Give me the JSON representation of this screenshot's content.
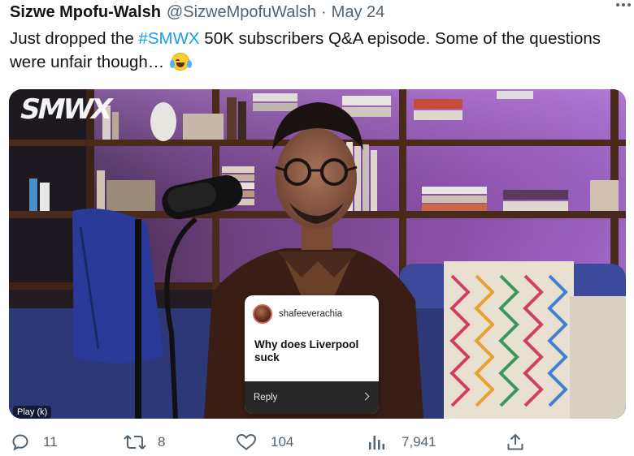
{
  "tweet": {
    "author_name": "Sizwe Mpofu-Walsh",
    "author_handle": "@SizweMpofuWalsh",
    "separator": "·",
    "time": "May 24",
    "text_before": "Just dropped the ",
    "hashtag": "#SMWX",
    "text_after": " 50K subscribers Q&A episode. Some of the questions were unfair though… ",
    "emoji": "face-with-tears-of-joy"
  },
  "media": {
    "logo": "SMWX",
    "question_card": {
      "username": "shafeeverachia",
      "question": "Why does Liverpool suck",
      "reply_label": "Reply"
    },
    "play_hint": "Play (k)"
  },
  "actions": {
    "replies": "11",
    "retweets": "8",
    "likes": "104",
    "views": "7,941"
  },
  "colors": {
    "accent": "#1d9bf0",
    "text": "#0f1419",
    "secondary": "#536471"
  }
}
